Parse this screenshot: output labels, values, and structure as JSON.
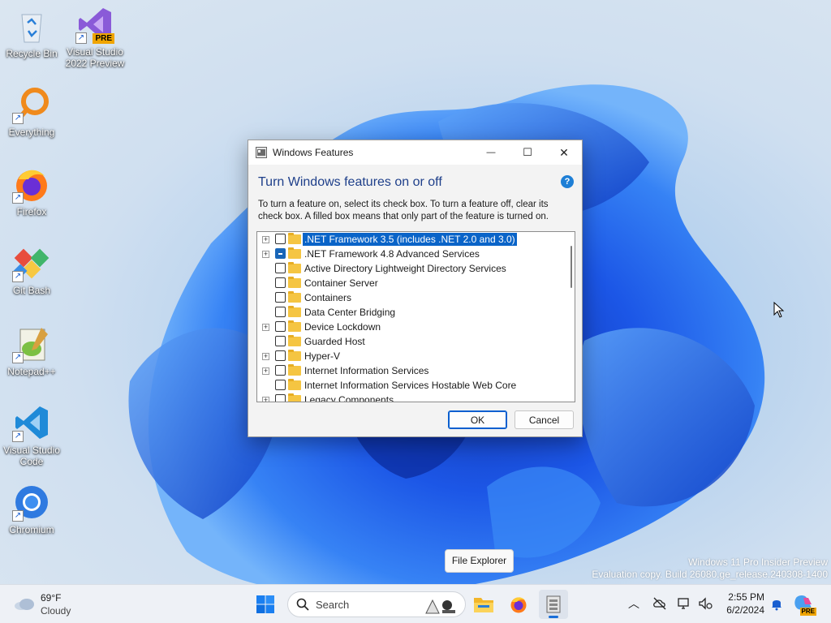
{
  "desktop": {
    "icons": [
      {
        "label": "Recycle Bin",
        "icon": "recycle-bin-icon"
      },
      {
        "label": "Visual Studio 2022 Preview",
        "icon": "visual-studio-preview-icon",
        "badge": "PRE"
      },
      {
        "label": "Everything",
        "icon": "everything-search-icon"
      },
      {
        "label": "Firefox",
        "icon": "firefox-icon"
      },
      {
        "label": "Git Bash",
        "icon": "git-bash-icon"
      },
      {
        "label": "Notepad++",
        "icon": "notepad-plus-plus-icon"
      },
      {
        "label": "Visual Studio Code",
        "icon": "vscode-icon"
      },
      {
        "label": "Chromium",
        "icon": "chromium-icon"
      }
    ]
  },
  "window": {
    "title": "Windows Features",
    "minimize": "—",
    "maximize": "☐",
    "close": "✕",
    "heading": "Turn Windows features on or off",
    "help": "?",
    "description": "To turn a feature on, select its check box. To turn a feature off, clear its check box. A filled box means that only part of the feature is turned on.",
    "features": [
      {
        "label": ".NET Framework 3.5 (includes .NET 2.0 and 3.0)",
        "expandable": true,
        "state": "unchecked",
        "selected": true
      },
      {
        "label": ".NET Framework 4.8 Advanced Services",
        "expandable": true,
        "state": "partial",
        "selected": false
      },
      {
        "label": "Active Directory Lightweight Directory Services",
        "expandable": false,
        "state": "unchecked",
        "selected": false
      },
      {
        "label": "Container Server",
        "expandable": false,
        "state": "unchecked",
        "selected": false
      },
      {
        "label": "Containers",
        "expandable": false,
        "state": "unchecked",
        "selected": false
      },
      {
        "label": "Data Center Bridging",
        "expandable": false,
        "state": "unchecked",
        "selected": false
      },
      {
        "label": "Device Lockdown",
        "expandable": true,
        "state": "unchecked",
        "selected": false
      },
      {
        "label": "Guarded Host",
        "expandable": false,
        "state": "unchecked",
        "selected": false
      },
      {
        "label": "Hyper-V",
        "expandable": true,
        "state": "unchecked",
        "selected": false
      },
      {
        "label": "Internet Information Services",
        "expandable": true,
        "state": "unchecked",
        "selected": false
      },
      {
        "label": "Internet Information Services Hostable Web Core",
        "expandable": false,
        "state": "unchecked",
        "selected": false
      },
      {
        "label": "Legacy Components",
        "expandable": true,
        "state": "unchecked",
        "selected": false
      }
    ],
    "ok": "OK",
    "cancel": "Cancel"
  },
  "tooltip": "File Explorer",
  "watermark": {
    "line1": "Windows 11 Pro Insider Preview",
    "line2": "Evaluation copy. Build 26080.ge_release.240308-1400"
  },
  "taskbar": {
    "weather": {
      "temp": "69°F",
      "condition": "Cloudy"
    },
    "search_placeholder": "Search",
    "pinned": [
      "start-icon",
      "file-explorer-icon",
      "firefox-icon",
      "windows-features-icon"
    ],
    "tray": {
      "time": "2:55 PM",
      "date": "6/2/2024",
      "copilot_badge": "PRE"
    }
  },
  "colors": {
    "accent": "#0a64c8",
    "heading": "#1e3f8a",
    "folder": "#f5c542"
  }
}
